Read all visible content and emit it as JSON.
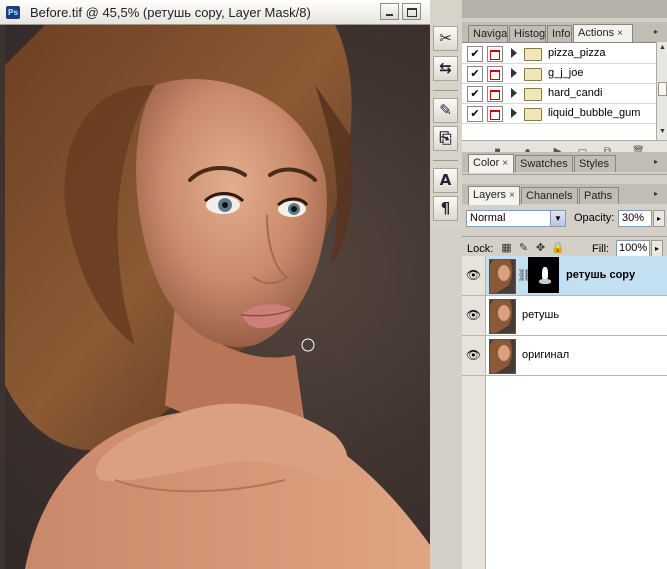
{
  "document": {
    "title": "Before.tif @ 45,5% (ретушь copy, Layer Mask/8)",
    "app_icon_text": "Ps"
  },
  "toolbar": {
    "tools": [
      "scissors-crossed-icon",
      "toggle-icon",
      "brush-tool-icon",
      "stamp-icon",
      "text-tool-icon",
      "paragraph-icon"
    ],
    "glyphs": [
      "✂",
      "⇆",
      "✎",
      "⎘",
      "A",
      "¶"
    ]
  },
  "panel_group1": {
    "tabs": [
      {
        "label": "Naviga",
        "close": false
      },
      {
        "label": "Histog",
        "close": false
      },
      {
        "label": "Info",
        "close": false
      },
      {
        "label": "Actions",
        "close": "×"
      }
    ],
    "actions": [
      {
        "checked": "✔",
        "name": "pizza_pizza"
      },
      {
        "checked": "✔",
        "name": "g_j_joe"
      },
      {
        "checked": "✔",
        "name": "hard_candi"
      },
      {
        "checked": "✔",
        "name": "liquid_bubble_gum"
      }
    ]
  },
  "panel_group2": {
    "tabs": [
      {
        "label": "Color",
        "close": "×"
      },
      {
        "label": "Swatches"
      },
      {
        "label": "Styles"
      }
    ]
  },
  "panel_group3": {
    "tabs": [
      {
        "label": "Layers",
        "close": "×"
      },
      {
        "label": "Channels"
      },
      {
        "label": "Paths"
      }
    ],
    "blend_mode": "Normal",
    "opacity_label": "Opacity:",
    "opacity": "30%",
    "lock_label": "Lock:",
    "fill_label": "Fill:",
    "fill": "100%",
    "layers": [
      {
        "name": "ретушь copy",
        "selected": true,
        "has_mask": true
      },
      {
        "name": "ретушь",
        "selected": false,
        "has_mask": false
      },
      {
        "name": "оригинал",
        "selected": false,
        "has_mask": false
      }
    ]
  },
  "colors": {
    "selection": "#c3dff2",
    "background": "#3f3330"
  }
}
